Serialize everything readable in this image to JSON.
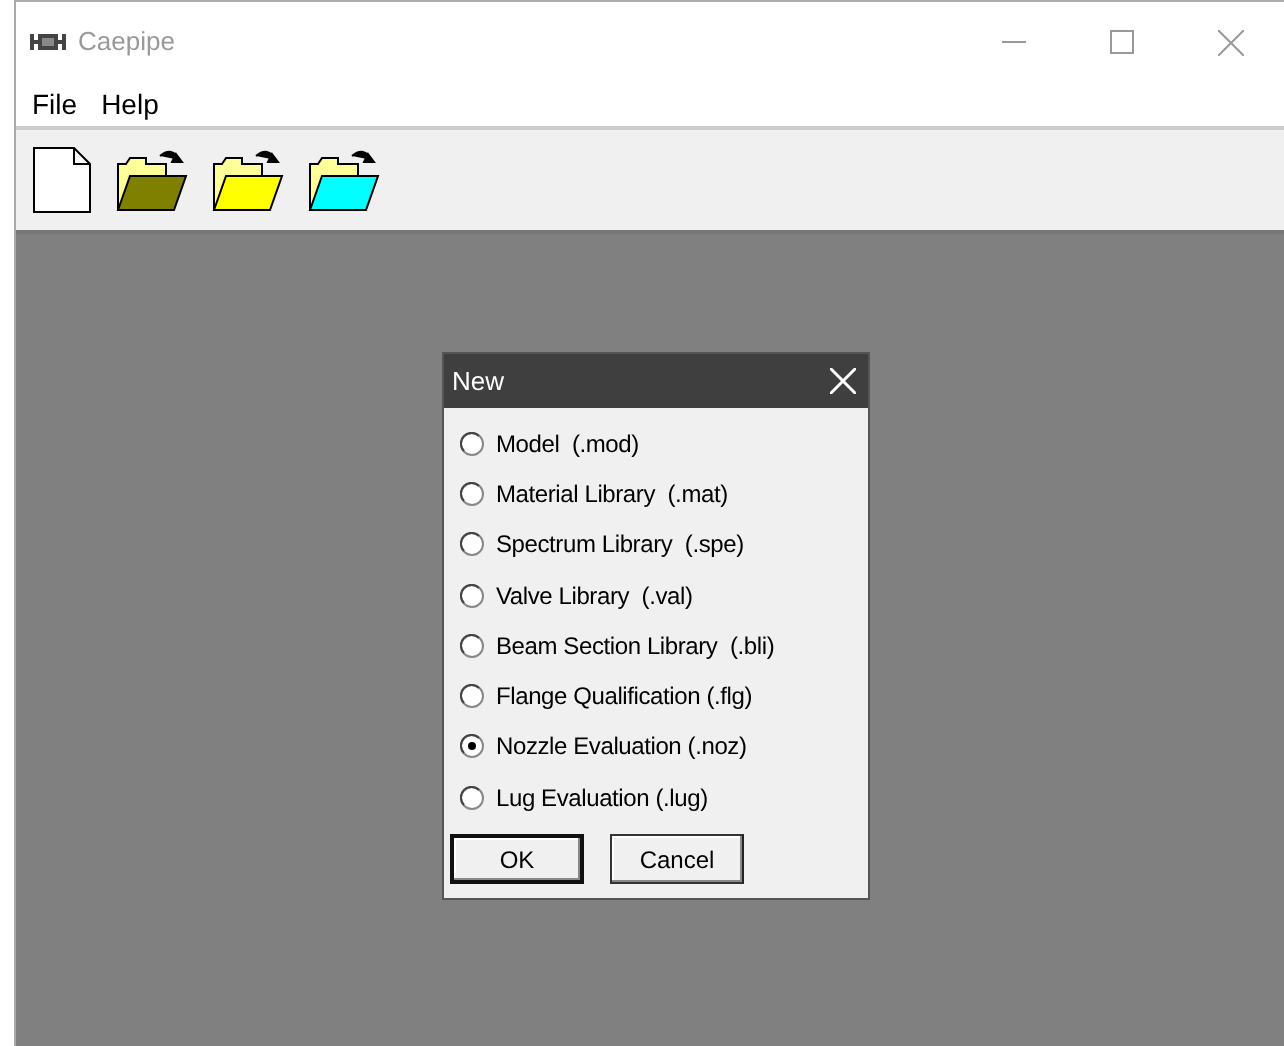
{
  "window": {
    "title": "Caepipe"
  },
  "menu": [
    "File",
    "Help"
  ],
  "dialog": {
    "title": "New",
    "options": [
      {
        "label": "Model  (.mod)",
        "selected": false
      },
      {
        "label": "Material Library  (.mat)",
        "selected": false
      },
      {
        "label": "Spectrum Library  (.spe)",
        "selected": false
      },
      {
        "label": "Valve Library  (.val)",
        "selected": false
      },
      {
        "label": "Beam Section Library  (.bli)",
        "selected": false
      },
      {
        "label": "Flange Qualification (.flg)",
        "selected": false
      },
      {
        "label": "Nozzle Evaluation (.noz)",
        "selected": true
      },
      {
        "label": "Lug Evaluation (.lug)",
        "selected": false
      }
    ],
    "buttons": [
      {
        "label": "OK",
        "kind": "default"
      },
      {
        "label": "Cancel",
        "kind": "normal"
      }
    ]
  }
}
